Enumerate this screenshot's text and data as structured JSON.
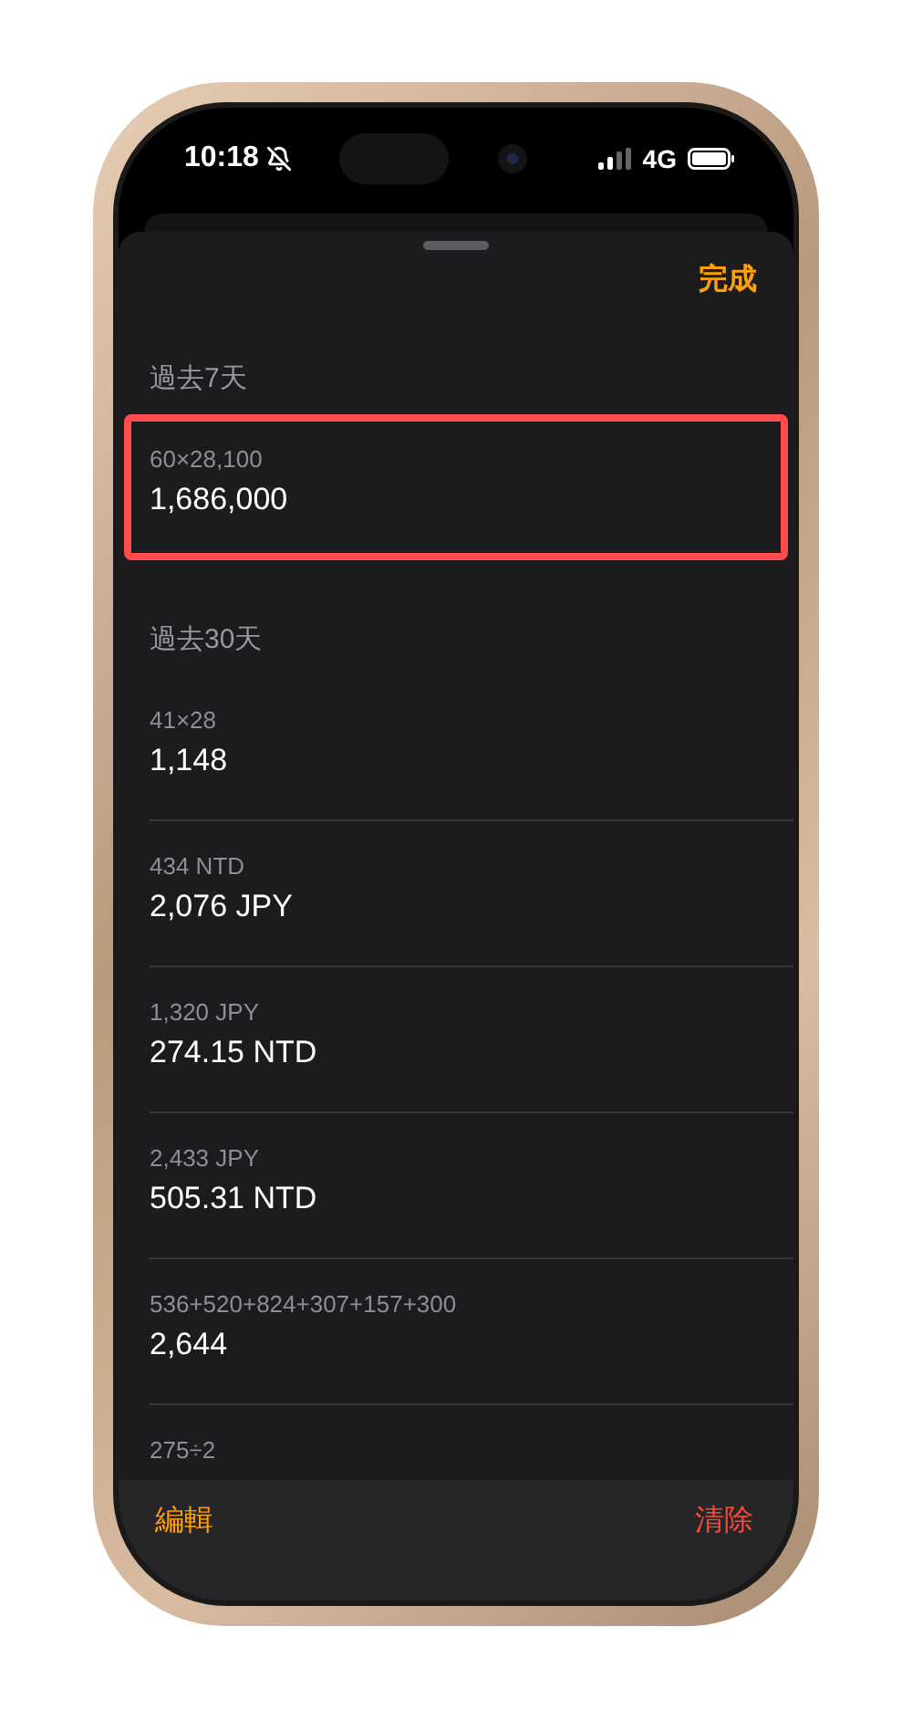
{
  "status_bar": {
    "time": "10:18",
    "network": "4G"
  },
  "done_button": "完成",
  "sections": [
    {
      "title": "過去7天",
      "items": [
        {
          "expression": "60×28,100",
          "result": "1,686,000",
          "highlighted": true
        }
      ]
    },
    {
      "title": "過去30天",
      "items": [
        {
          "expression": "41×28",
          "result": "1,148",
          "highlighted": false
        },
        {
          "expression": "434 NTD",
          "result": "2,076 JPY",
          "highlighted": false
        },
        {
          "expression": "1,320 JPY",
          "result": "274.15 NTD",
          "highlighted": false
        },
        {
          "expression": "2,433 JPY",
          "result": "505.31 NTD",
          "highlighted": false
        },
        {
          "expression": "536+520+824+307+157+300",
          "result": "2,644",
          "highlighted": false
        },
        {
          "expression": "275÷2",
          "highlighted": false
        }
      ]
    }
  ],
  "toolbar": {
    "edit": "編輯",
    "clear": "清除"
  }
}
